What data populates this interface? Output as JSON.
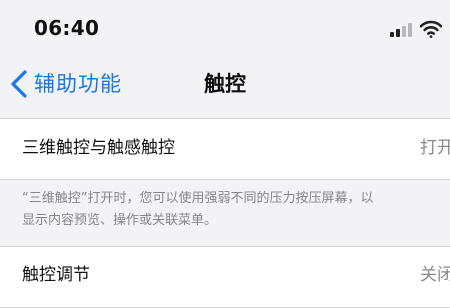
{
  "status_bar": {
    "time": "06:40"
  },
  "nav": {
    "back_label": "辅助功能",
    "title": "触控"
  },
  "section_3d": {
    "label": "三维触控与触感触控",
    "value": "打开",
    "footer_line1": "“三维触控”打开时，您可以使用强弱不同的压力按压屏幕，以",
    "footer_line2": "显示内容预览、操作或关联菜单。"
  },
  "section_adjust": {
    "label": "触控调节",
    "value": "关闭"
  },
  "colors": {
    "accent": "#1677f0",
    "background": "#f2f2f7",
    "secondary_text": "#8a8a8e"
  }
}
